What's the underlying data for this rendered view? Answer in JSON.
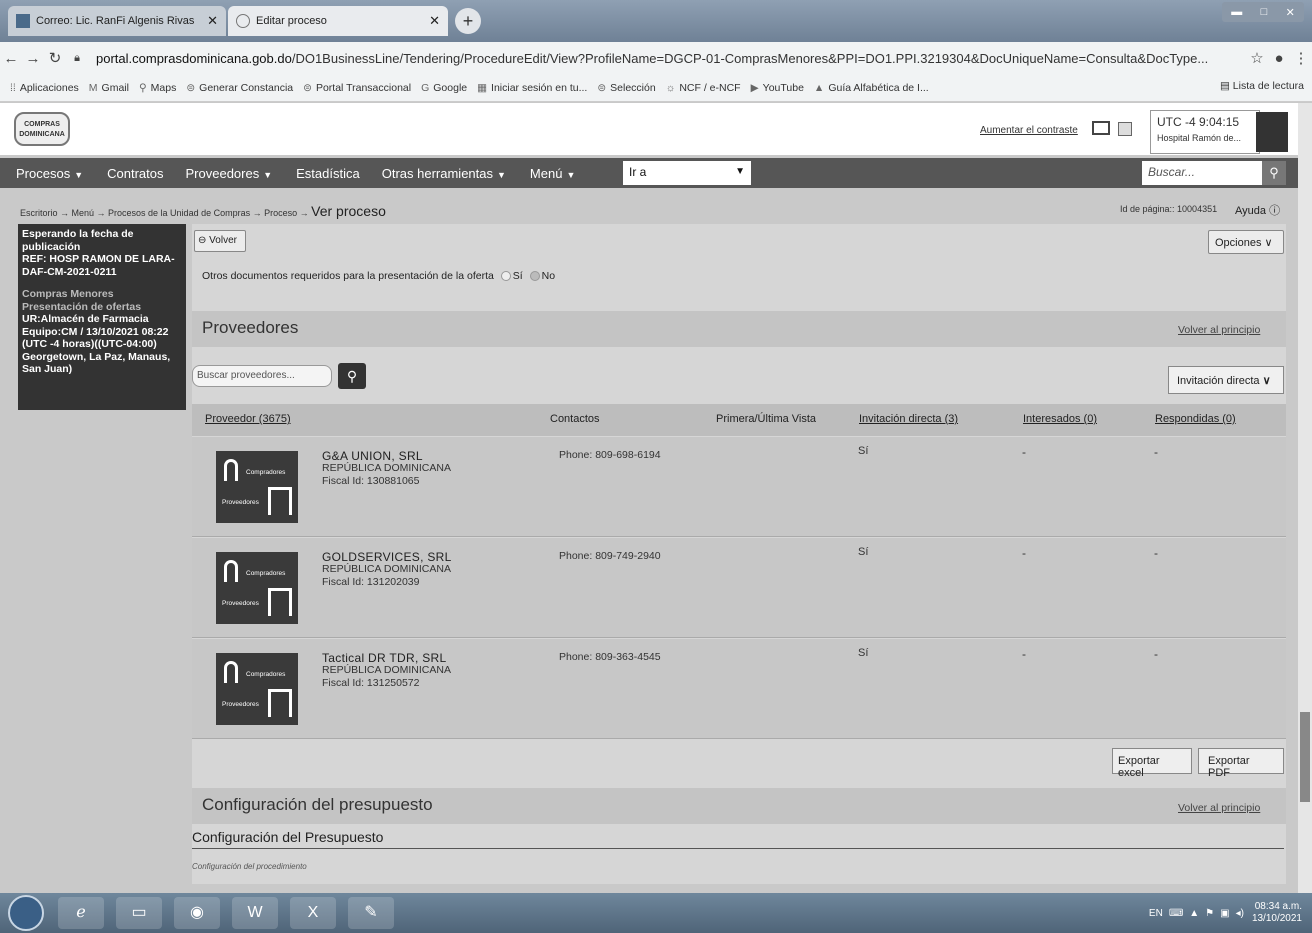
{
  "browser": {
    "tabs": [
      {
        "label": "Correo: Lic. RanFi Algenis Rivas",
        "icon": "mail-icon"
      },
      {
        "label": "Editar proceso",
        "icon": "page-icon"
      }
    ],
    "url_domain": "portal.comprasdominicana.gob.do",
    "url_path": "/DO1BusinessLine/Tendering/ProcedureEdit/View?ProfileName=DGCP-01-ComprasMenores&PPI=DO1.PPI.3219304&DocUniqueName=Consulta&DocType...",
    "bookmarks": [
      {
        "label": "Aplicaciones",
        "icon": "apps-icon"
      },
      {
        "label": "Gmail",
        "icon": "gmail-icon"
      },
      {
        "label": "Maps",
        "icon": "maps-icon"
      },
      {
        "label": "Generar Constancia",
        "icon": "link-icon"
      },
      {
        "label": "Portal Transaccional",
        "icon": "link-icon"
      },
      {
        "label": "Google",
        "icon": "google-icon"
      },
      {
        "label": "Iniciar sesión en tu...",
        "icon": "windows-icon"
      },
      {
        "label": "Selección",
        "icon": "link-icon"
      },
      {
        "label": "NCF / e-NCF",
        "icon": "gear-icon"
      },
      {
        "label": "YouTube",
        "icon": "youtube-icon"
      },
      {
        "label": "Guía Alfabética de I...",
        "icon": "bookmark-icon"
      }
    ],
    "reading_list": "Lista de lectura"
  },
  "header": {
    "logo_text": "COMPRAS DOMINICANA",
    "contrast_link": "Aumentar el contraste",
    "utc": "UTC -4 9:04:15",
    "hospital": "Hospital Ramón de..."
  },
  "menu": {
    "items": [
      "Procesos",
      "Contratos",
      "Proveedores",
      "Estadística",
      "Otras herramientas",
      "Menú"
    ],
    "goto": "Ir a",
    "search_placeholder": "Buscar..."
  },
  "breadcrumb": {
    "path": "Escritorio → Menú → Procesos de la Unidad de Compras → Proceso →",
    "current": "Ver proceso",
    "page_id": "Id de página:: 10004351",
    "help": "Ayuda"
  },
  "left_panel": {
    "status": "Esperando la fecha de publicación",
    "ref": "REF: HOSP RAMON DE LARA-DAF-CM-2021-0211",
    "type": "Compras Menores",
    "phase": "Presentación de ofertas",
    "ur": "UR:Almacén de Farmacia",
    "equipo": "Equipo:CM / 13/10/2021 08:22 (UTC -4 horas)((UTC-04:00) Georgetown, La Paz, Manaus, San Juan)"
  },
  "main": {
    "back_button": "Volver",
    "options_button": "Opciones",
    "otros_docs_label": "Otros documentos requeridos para la presentación de la oferta",
    "radio_yes": "Sí",
    "radio_no": "No",
    "providers_title": "Proveedores",
    "back_to_top": "Volver al principio",
    "search_providers_placeholder": "Buscar proveedores...",
    "filter_select": "Invitación directa",
    "columns": {
      "proveedor": "Proveedor (3675)",
      "contactos": "Contactos",
      "vista": "Primera/Última Vista",
      "invitacion": "Invitación directa (3)",
      "interesados": "Interesados (0)",
      "respondidas": "Respondidas (0)"
    },
    "rows": [
      {
        "name": "G&A UNION, SRL",
        "country": "REPÚBLICA DOMINICANA",
        "fiscal": "Fiscal Id: 130881065",
        "phone": "Phone: 809-698-6194",
        "invitacion": "Sí",
        "interesados": "-",
        "respondidas": "-",
        "logo_top": "Compradores",
        "logo_bottom": "Proveedores"
      },
      {
        "name": "GOLDSERVICES, SRL",
        "country": "REPÚBLICA DOMINICANA",
        "fiscal": "Fiscal Id: 131202039",
        "phone": "Phone: 809-749-2940",
        "invitacion": "Sí",
        "interesados": "-",
        "respondidas": "-",
        "logo_top": "Compradores",
        "logo_bottom": "Proveedores"
      },
      {
        "name": "Tactical DR TDR, SRL",
        "country": "REPÚBLICA DOMINICANA",
        "fiscal": "Fiscal Id: 131250572",
        "phone": "Phone: 809-363-4545",
        "invitacion": "Sí",
        "interesados": "-",
        "respondidas": "-",
        "logo_top": "Compradores",
        "logo_bottom": "Proveedores"
      }
    ],
    "export_excel": "Exportar excel",
    "export_pdf": "Exportar PDF",
    "budget_title": "Configuración del presupuesto",
    "budget_subtitle": "Configuración del Presupuesto",
    "procedure_config": "Configuración del procedimiento"
  },
  "taskbar": {
    "lang": "EN",
    "time": "08:34 a.m.",
    "date": "13/10/2021"
  }
}
